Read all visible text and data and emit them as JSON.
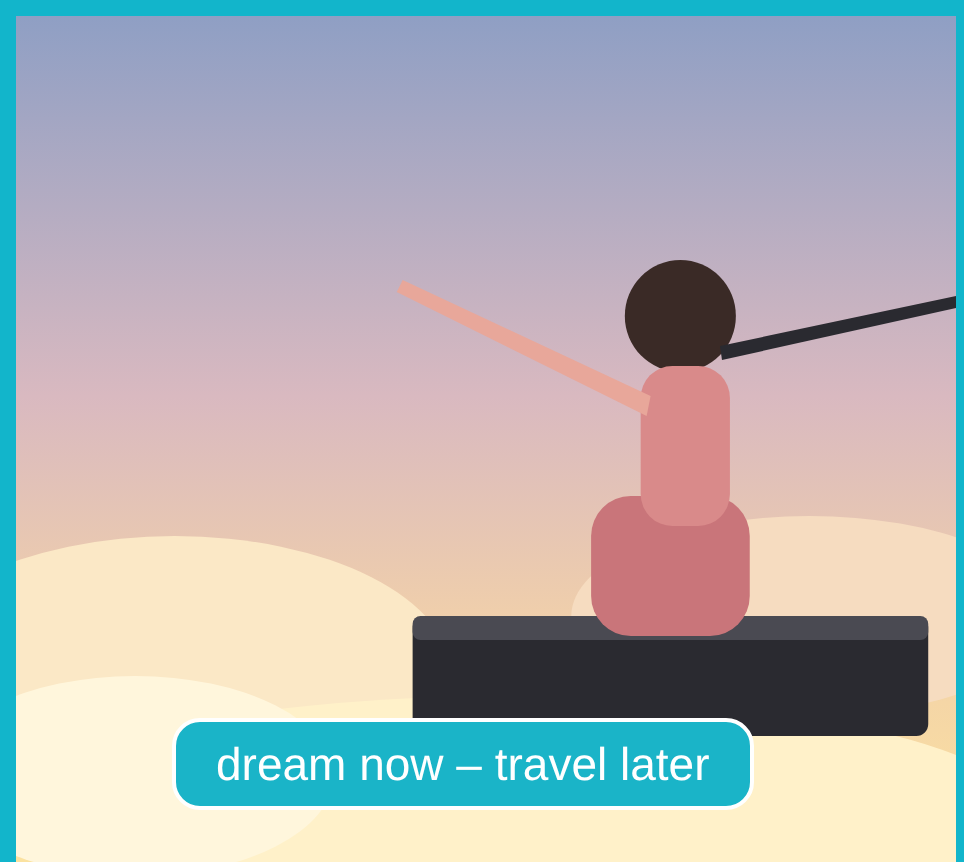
{
  "banner": {
    "caption": "dream now – travel later"
  }
}
